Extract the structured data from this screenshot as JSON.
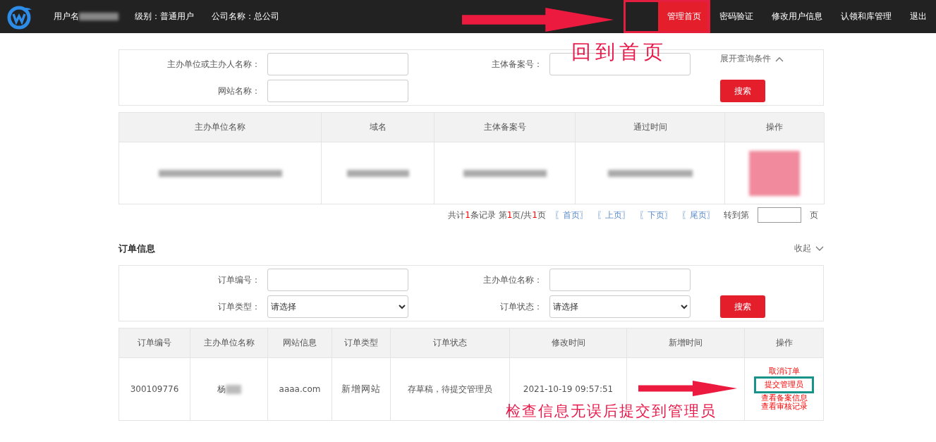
{
  "header": {
    "user_label": "用户名",
    "level": "级别：普通用户",
    "company": "公司名称：总公司",
    "nav": [
      {
        "label": "管理首页",
        "selected": true
      },
      {
        "label": "密码验证",
        "selected": false
      },
      {
        "label": "修改用户信息",
        "selected": false
      },
      {
        "label": "认领和库管理",
        "selected": false
      },
      {
        "label": "退出",
        "selected": false
      }
    ]
  },
  "annotations": [
    {
      "kind": "callout",
      "text": "回到首页"
    },
    {
      "kind": "callout",
      "text": "检查信息无误后提交到管理员"
    }
  ],
  "site_search": {
    "fields": [
      {
        "label": "主办单位或主办人名称："
      },
      {
        "label": "主体备案号："
      },
      {
        "label": "网站名称："
      }
    ],
    "expand": "展开查询条件",
    "button": "搜索"
  },
  "site_table": {
    "columns": [
      "主办单位名称",
      "域名",
      "主体备案号",
      "通过时间",
      "操作"
    ]
  },
  "pagination": {
    "summary": [
      {
        "text": "共计",
        "highlight": false
      },
      {
        "text": "1",
        "highlight": true
      },
      {
        "text": "条记录 第",
        "highlight": false
      },
      {
        "text": "1",
        "highlight": true
      },
      {
        "text": "页/共",
        "highlight": false
      },
      {
        "text": "1",
        "highlight": true
      },
      {
        "text": "页",
        "highlight": false
      }
    ],
    "links": [
      "〖首页〗",
      "〖上页〗",
      "〖下页〗",
      "〖尾页〗"
    ],
    "goto": "转到第",
    "page_unit": "页"
  },
  "orders": {
    "title": "订单信息",
    "collapse": "收起",
    "fields": [
      {
        "kind": "input",
        "label": "订单编号："
      },
      {
        "kind": "input",
        "label": "主办单位名称："
      },
      {
        "kind": "select",
        "label": "订单类型：",
        "value": "请选择"
      },
      {
        "kind": "select",
        "label": "订单状态：",
        "value": "请选择"
      }
    ],
    "button": "搜索",
    "columns": [
      "订单编号",
      "主办单位名称",
      "网站信息",
      "订单类型",
      "订单状态",
      "修改时间",
      "新增时间",
      "操作"
    ],
    "row": {
      "order_no": "300109776",
      "owner": "杨",
      "site": "aaaa.com",
      "type": "新增网站",
      "status": "存草稿，待提交管理员",
      "modified": "2021-10-19 09:57:51",
      "actions": [
        {
          "label": "取消订单",
          "highlighted": false
        },
        {
          "label": "提交管理员",
          "highlighted": true
        },
        {
          "label": "查看备案信息",
          "highlighted": false
        },
        {
          "label": "查看审核记录",
          "highlighted": false
        }
      ]
    }
  }
}
